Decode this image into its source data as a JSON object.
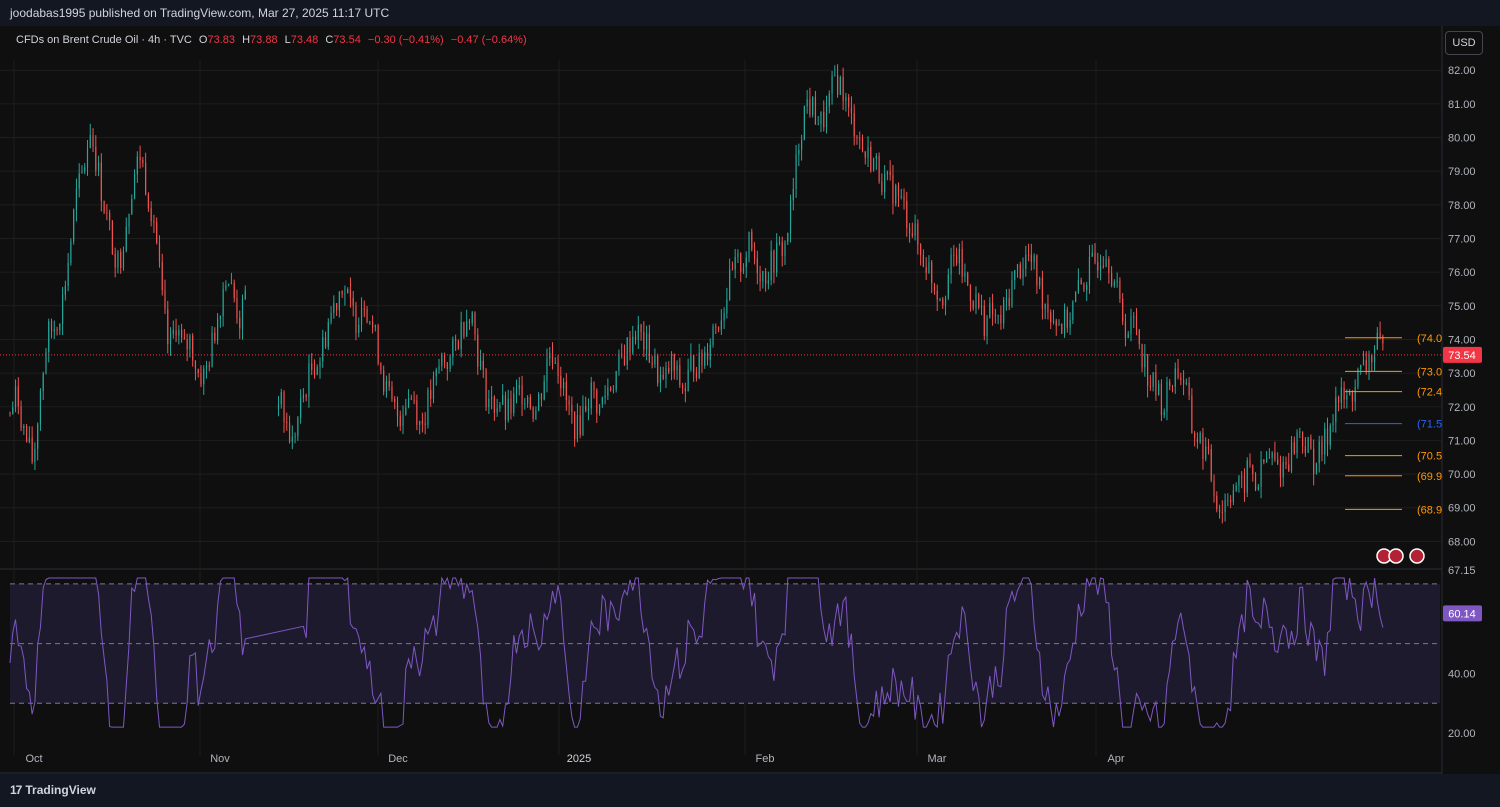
{
  "header": {
    "published": "joodabas1995 published on TradingView.com, Mar 27, 2025 11:17 UTC"
  },
  "legend": {
    "symbol": "CFDs on Brent Crude Oil · 4h · TVC",
    "o_label": "O",
    "o": "73.83",
    "h_label": "H",
    "h": "73.88",
    "l_label": "L",
    "l": "73.48",
    "c_label": "C",
    "c": "73.54",
    "change": "−0.30 (−0.41%)",
    "change2": "−0.47 (−0.64%)"
  },
  "currency_button": "USD",
  "brand": {
    "name": "TradingView",
    "mark": "17"
  },
  "colors": {
    "bg": "#0f0f0f",
    "up": "#26a69a",
    "down": "#ef5350",
    "grid": "#1e1e1e",
    "level_orange": "#ff9800",
    "level_blue": "#2962ff",
    "rsi": "#7e57c2",
    "rsi_band": "#1e1a2e",
    "price_tag": "#f23645",
    "rsi_tag": "#7e57c2"
  },
  "chart_data": [
    {
      "type": "candlestick",
      "title": "CFDs on Brent Crude Oil · 4h · TVC",
      "ylim": [
        67.15,
        82.6
      ],
      "y_ticks": [
        "82.00",
        "81.00",
        "80.00",
        "79.00",
        "78.00",
        "77.00",
        "76.00",
        "75.00",
        "74.00",
        "73.00",
        "72.00",
        "71.00",
        "70.00",
        "69.00",
        "68.00",
        "67.15"
      ],
      "x_ticks": [
        "Oct",
        "Nov",
        "Dec",
        "2025",
        "Feb",
        "Mar",
        "Apr"
      ],
      "close_path": [
        [
          0,
          71.8
        ],
        [
          4,
          72.4
        ],
        [
          8,
          71.2
        ],
        [
          13,
          70.3
        ],
        [
          17,
          72.5
        ],
        [
          21,
          74.1
        ],
        [
          25,
          74.4
        ],
        [
          29,
          75.0
        ],
        [
          33,
          76.5
        ],
        [
          37,
          78.2
        ],
        [
          41,
          79.0
        ],
        [
          45,
          80.3
        ],
        [
          49,
          79.1
        ],
        [
          53,
          77.9
        ],
        [
          57,
          76.9
        ],
        [
          61,
          76.2
        ],
        [
          65,
          77.5
        ],
        [
          69,
          78.8
        ],
        [
          73,
          79.5
        ],
        [
          77,
          78.4
        ],
        [
          81,
          77.5
        ],
        [
          85,
          75.2
        ],
        [
          89,
          73.6
        ],
        [
          93,
          74.5
        ],
        [
          97,
          73.6
        ],
        [
          101,
          74.0
        ],
        [
          105,
          73.0
        ],
        [
          109,
          72.9
        ],
        [
          113,
          73.8
        ],
        [
          117,
          74.9
        ],
        [
          121,
          76.0
        ],
        [
          125,
          75.3
        ],
        [
          129,
          74.5
        ],
        [
          133,
          75.5
        ],
        [
          150,
          72.4
        ],
        [
          154,
          71.6
        ],
        [
          158,
          70.9
        ],
        [
          162,
          71.8
        ],
        [
          166,
          72.7
        ],
        [
          170,
          73.3
        ],
        [
          174,
          73.5
        ],
        [
          178,
          74.5
        ],
        [
          182,
          75.1
        ],
        [
          186,
          75.7
        ],
        [
          190,
          75.0
        ],
        [
          194,
          74.6
        ],
        [
          198,
          75.3
        ],
        [
          202,
          74.6
        ],
        [
          206,
          73.7
        ],
        [
          210,
          72.6
        ],
        [
          214,
          72.0
        ],
        [
          218,
          71.7
        ],
        [
          222,
          72.3
        ],
        [
          226,
          72.3
        ],
        [
          230,
          71.4
        ],
        [
          234,
          72.1
        ],
        [
          238,
          72.7
        ],
        [
          242,
          73.5
        ],
        [
          246,
          73.3
        ],
        [
          250,
          73.9
        ],
        [
          254,
          74.5
        ],
        [
          258,
          75.0
        ],
        [
          262,
          73.6
        ],
        [
          266,
          72.5
        ],
        [
          270,
          72.0
        ],
        [
          274,
          72.2
        ],
        [
          278,
          71.7
        ],
        [
          282,
          72.1
        ],
        [
          286,
          72.5
        ],
        [
          290,
          72.4
        ],
        [
          294,
          71.8
        ],
        [
          298,
          72.6
        ],
        [
          302,
          73.7
        ],
        [
          306,
          73.5
        ],
        [
          310,
          72.4
        ],
        [
          314,
          71.7
        ],
        [
          318,
          71.3
        ],
        [
          322,
          72.1
        ],
        [
          326,
          72.5
        ],
        [
          330,
          71.9
        ],
        [
          334,
          72.5
        ],
        [
          338,
          72.8
        ],
        [
          342,
          73.3
        ],
        [
          346,
          73.8
        ],
        [
          350,
          74.3
        ],
        [
          354,
          74.0
        ],
        [
          358,
          73.6
        ],
        [
          362,
          73.1
        ],
        [
          366,
          72.6
        ],
        [
          370,
          73.3
        ],
        [
          374,
          72.8
        ],
        [
          378,
          72.5
        ],
        [
          382,
          73.4
        ],
        [
          386,
          73.2
        ],
        [
          390,
          73.7
        ],
        [
          394,
          74.4
        ],
        [
          398,
          74.7
        ],
        [
          402,
          75.5
        ],
        [
          406,
          76.1
        ],
        [
          410,
          76.3
        ],
        [
          414,
          76.8
        ],
        [
          418,
          76.3
        ],
        [
          422,
          75.9
        ],
        [
          426,
          76.2
        ],
        [
          430,
          76.6
        ],
        [
          434,
          76.8
        ],
        [
          438,
          78.1
        ],
        [
          442,
          80.0
        ],
        [
          446,
          81.1
        ],
        [
          450,
          80.8
        ],
        [
          454,
          80.4
        ],
        [
          458,
          80.8
        ],
        [
          462,
          81.8
        ],
        [
          466,
          81.5
        ],
        [
          470,
          80.6
        ],
        [
          474,
          80.3
        ],
        [
          478,
          79.5
        ],
        [
          482,
          79.4
        ],
        [
          486,
          79.1
        ],
        [
          490,
          78.6
        ],
        [
          494,
          78.5
        ],
        [
          498,
          78.2
        ],
        [
          502,
          77.7
        ],
        [
          506,
          77.2
        ],
        [
          510,
          76.5
        ],
        [
          514,
          76.2
        ],
        [
          518,
          75.6
        ],
        [
          522,
          75.3
        ],
        [
          526,
          76.0
        ],
        [
          530,
          76.5
        ],
        [
          534,
          75.9
        ],
        [
          538,
          75.4
        ],
        [
          542,
          75.0
        ],
        [
          546,
          74.5
        ],
        [
          550,
          74.8
        ],
        [
          554,
          74.4
        ],
        [
          558,
          75.1
        ],
        [
          562,
          75.8
        ],
        [
          566,
          76.2
        ],
        [
          570,
          76.5
        ],
        [
          574,
          76.0
        ],
        [
          578,
          75.3
        ],
        [
          582,
          74.9
        ],
        [
          586,
          74.6
        ],
        [
          590,
          74.4
        ],
        [
          594,
          74.8
        ],
        [
          598,
          75.4
        ],
        [
          602,
          75.8
        ],
        [
          606,
          76.2
        ],
        [
          610,
          76.5
        ],
        [
          614,
          76.7
        ],
        [
          618,
          75.8
        ],
        [
          622,
          74.9
        ],
        [
          626,
          74.2
        ],
        [
          630,
          74.6
        ],
        [
          634,
          73.6
        ],
        [
          638,
          72.8
        ],
        [
          642,
          72.5
        ],
        [
          646,
          72.0
        ],
        [
          650,
          72.8
        ],
        [
          654,
          73.1
        ],
        [
          658,
          72.7
        ],
        [
          662,
          71.3
        ],
        [
          666,
          71.0
        ],
        [
          670,
          70.6
        ],
        [
          674,
          69.6
        ],
        [
          678,
          68.9
        ],
        [
          682,
          69.4
        ],
        [
          686,
          69.7
        ],
        [
          690,
          69.5
        ],
        [
          694,
          70.3
        ],
        [
          698,
          69.6
        ],
        [
          702,
          70.3
        ],
        [
          706,
          70.5
        ],
        [
          710,
          70.2
        ],
        [
          714,
          70.3
        ],
        [
          718,
          70.7
        ],
        [
          722,
          71.3
        ],
        [
          726,
          70.8
        ],
        [
          730,
          70.4
        ],
        [
          734,
          70.6
        ],
        [
          738,
          71.2
        ],
        [
          742,
          72.2
        ],
        [
          746,
          72.2
        ],
        [
          750,
          72.2
        ],
        [
          754,
          72.8
        ],
        [
          758,
          73.1
        ],
        [
          762,
          73.5
        ],
        [
          766,
          73.8
        ],
        [
          770,
          73.54
        ]
      ],
      "last_price": "73.54",
      "levels": [
        {
          "label": "(74.0",
          "value": 74.05,
          "color": "#ff9800"
        },
        {
          "label": "(73.0",
          "value": 73.05,
          "color": "#ff9800"
        },
        {
          "label": "(72.4",
          "value": 72.45,
          "color": "#ff9800"
        },
        {
          "label": "(71.5",
          "value": 71.5,
          "color": "#2962ff"
        },
        {
          "label": "(70.5",
          "value": 70.55,
          "color": "#ff9800"
        },
        {
          "label": "(69.9",
          "value": 69.95,
          "color": "#ff9800"
        },
        {
          "label": "(68.9",
          "value": 68.95,
          "color": "#ff9800"
        }
      ]
    },
    {
      "type": "line",
      "title": "",
      "ylim": [
        16,
        74
      ],
      "y_ticks": [
        "40.00",
        "20.00"
      ],
      "bands": [
        70,
        50,
        30
      ],
      "last_value": "60.14"
    }
  ]
}
